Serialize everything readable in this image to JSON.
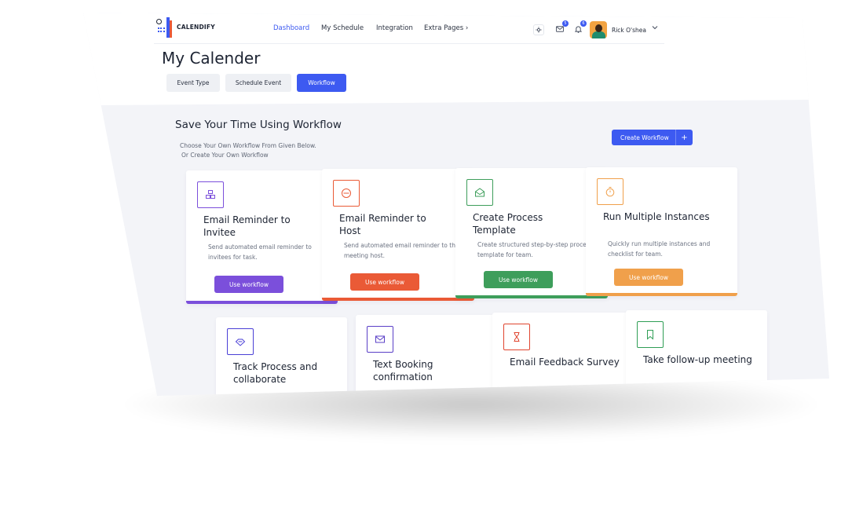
{
  "app": {
    "name": "CALENDIFY"
  },
  "nav": {
    "items": [
      "Dashboard",
      "My Schedule",
      "Integration",
      "Extra Pages ›"
    ],
    "active": "Dashboard"
  },
  "header": {
    "user_name": "Rick O'shea",
    "badges": {
      "messages": "5",
      "notifications": "6"
    },
    "icons": [
      "settings-icon",
      "mail-icon",
      "bell-icon",
      "chevron-down-icon"
    ]
  },
  "page": {
    "title": "My Calender",
    "tabs": [
      "Event Type",
      "Schedule Event",
      "Workflow"
    ],
    "active_tab": "Workflow"
  },
  "workflow": {
    "heading": "Save Your Time Using Workflow",
    "subtitle_line1": "Choose Your Own Workflow From Given Below.",
    "subtitle_line2": "Or Create Your Own Workflow",
    "create_label": "Create Workflow",
    "create_icon": "plus-icon",
    "cards": [
      {
        "title": "Email Reminder to Invitee",
        "desc": "Send automated email reminder to invitees for task.",
        "button": "Use workflow",
        "color": "#7b4fdb",
        "icon": "cubes-icon"
      },
      {
        "title": "Email Reminder to Host",
        "desc": "Send automated email reminder to the meeting host.",
        "button": "Use workflow",
        "color": "#ea5a36",
        "icon": "at-sign-icon"
      },
      {
        "title": "Create Process Template",
        "desc": "Create structured step-by-step process template for team.",
        "button": "Use workflow",
        "color": "#3e9e5b",
        "icon": "open-envelope-icon"
      },
      {
        "title": "Run Multiple Instances",
        "desc": "Quickly run multiple instances and checklist for team.",
        "button": "Use workflow",
        "color": "#f0a04b",
        "icon": "stopwatch-icon"
      },
      {
        "title": "Track Process and collaborate",
        "color": "#4a3fd6",
        "icon": "handshake-icon"
      },
      {
        "title": "Text Booking confirmation",
        "color": "#5a3fc7",
        "icon": "mail-icon"
      },
      {
        "title": "Email Feedback Survey",
        "color": "#e0452f",
        "icon": "hourglass-icon"
      },
      {
        "title": "Take follow-up meeting",
        "color": "#2f9e55",
        "icon": "bookmark-icon"
      }
    ]
  }
}
